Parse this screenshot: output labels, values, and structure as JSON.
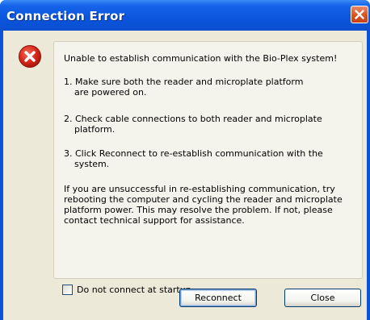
{
  "window": {
    "title": "Connection Error"
  },
  "dialog": {
    "headline": "Unable to establish communication with the Bio-Plex system!",
    "steps": [
      {
        "line1": "1. Make sure both the reader and microplate platform",
        "line2": "are powered on."
      },
      {
        "line1": "2. Check cable connections to both reader and microplate",
        "line2": "platform."
      },
      {
        "line1": "3. Click Reconnect to re-establish communication with the",
        "line2": "system."
      }
    ],
    "advice_lines": [
      "If you are unsuccessful in re-establishing communication, try",
      "rebooting the computer and cycling the reader and microplate",
      "platform power. This may resolve the problem. If not, please",
      "contact technical support for assistance."
    ],
    "checkbox_label": "Do not connect at startup",
    "checkbox_checked": false
  },
  "buttons": {
    "reconnect": "Reconnect",
    "close": "Close"
  },
  "icons": {
    "error": "error-icon",
    "title_close": "close-icon"
  },
  "colors": {
    "titlebar": "#0a55dc",
    "dialog_bg": "#ece9d8",
    "error_red": "#d92b1c"
  }
}
